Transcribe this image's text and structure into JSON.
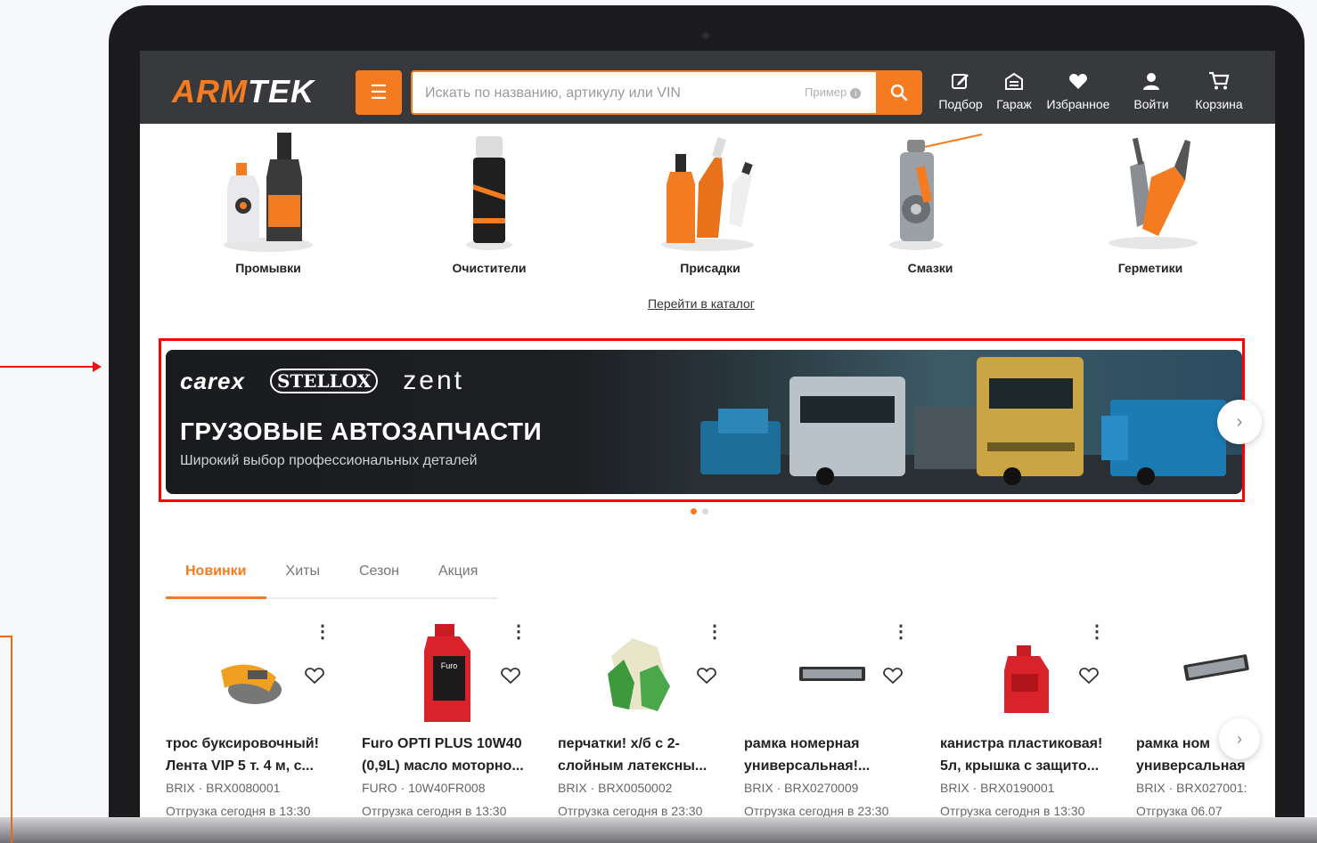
{
  "header": {
    "logo_part1": "ARM",
    "logo_part2": "TEK",
    "search_placeholder": "Искать по названию, артикулу или VIN",
    "search_example": "Пример",
    "nav": [
      {
        "label": "Подбор",
        "icon": "edit-icon"
      },
      {
        "label": "Гараж",
        "icon": "garage-icon"
      },
      {
        "label": "Избранное",
        "icon": "heart-icon"
      },
      {
        "label": "Войти",
        "icon": "user-icon"
      },
      {
        "label": "Корзина",
        "icon": "cart-icon"
      }
    ]
  },
  "categories": [
    {
      "name": "Промывки"
    },
    {
      "name": "Очистители"
    },
    {
      "name": "Присадки"
    },
    {
      "name": "Смазки"
    },
    {
      "name": "Герметики"
    }
  ],
  "catalog_link": "Перейти в каталог",
  "banner": {
    "brands": [
      "carex",
      "STELLOX",
      "zent"
    ],
    "title": "ГРУЗОВЫЕ АВТОЗАПЧАСТИ",
    "subtitle": "Широкий выбор профессиональных деталей",
    "slide_count": 2,
    "active_slide": 1
  },
  "tabs": [
    {
      "label": "Новинки",
      "active": true
    },
    {
      "label": "Хиты",
      "active": false
    },
    {
      "label": "Сезон",
      "active": false
    },
    {
      "label": "Акция",
      "active": false
    }
  ],
  "products": [
    {
      "line1": "трос буксировочный!",
      "line2": "Лента VIP 5 т. 4 м, с...",
      "meta": "BRIX · BRX0080001",
      "ship": "Отгрузка сегодня в 13:30"
    },
    {
      "line1": "Furo OPTI PLUS 10W40",
      "line2": "(0,9L) масло моторно...",
      "meta": "FURO · 10W40FR008",
      "ship": "Отгрузка сегодня в 13:30"
    },
    {
      "line1": "перчатки! х/б с 2-",
      "line2": "слойным латексны...",
      "meta": "BRIX · BRX0050002",
      "ship": "Отгрузка сегодня в 23:30"
    },
    {
      "line1": "рамка номерная",
      "line2": "универсальная!...",
      "meta": "BRIX · BRX0270009",
      "ship": "Отгрузка сегодня в 23:30"
    },
    {
      "line1": "канистра пластиковая!",
      "line2": "5л, крышка с защито...",
      "meta": "BRIX · BRX0190001",
      "ship": "Отгрузка сегодня в 13:30"
    },
    {
      "line1": "рамка ном",
      "line2": "универсальная",
      "meta": "BRIX · BRX027001:",
      "ship": "Отгрузка 06.07"
    }
  ],
  "colors": {
    "accent": "#f47b20",
    "header_bg": "#37393d",
    "highlight": "#ff0000"
  }
}
